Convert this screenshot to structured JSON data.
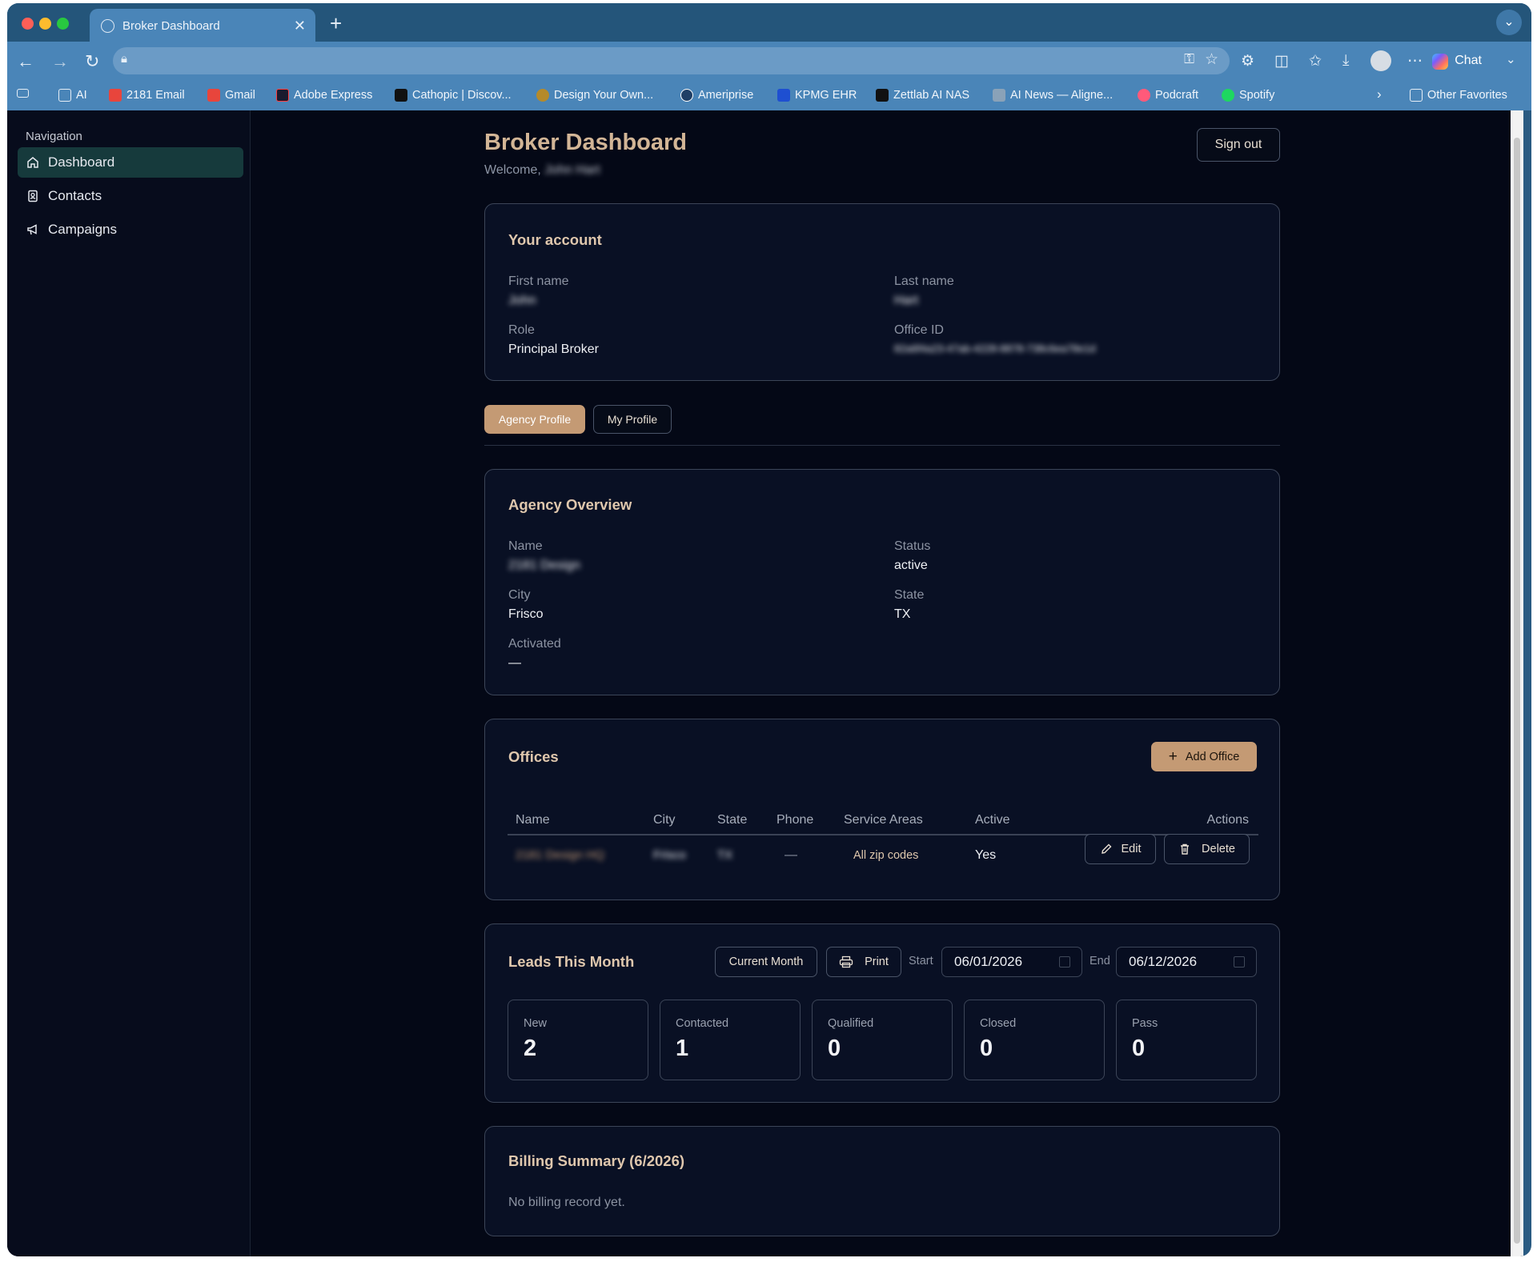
{
  "browser": {
    "tab_title": "Broker Dashboard",
    "chat_label": "Chat",
    "bookmarks": [
      {
        "label": "AI",
        "icon": "folder-icon"
      },
      {
        "label": "2181 Email",
        "icon": "gmail-icon"
      },
      {
        "label": "Gmail",
        "icon": "gmail-icon"
      },
      {
        "label": "Adobe Express",
        "icon": "adobe-express-icon"
      },
      {
        "label": "Cathopic | Discov...",
        "icon": "cathopic-icon"
      },
      {
        "label": "Design Your Own...",
        "icon": "design-icon"
      },
      {
        "label": "Ameriprise",
        "icon": "ameriprise-icon"
      },
      {
        "label": "KPMG EHR",
        "icon": "kpmg-icon"
      },
      {
        "label": "Zettlab AI NAS",
        "icon": "zettlab-icon"
      },
      {
        "label": "AI News — Aligne...",
        "icon": "ai-news-icon"
      },
      {
        "label": "Podcraft",
        "icon": "podcraft-icon"
      },
      {
        "label": "Spotify",
        "icon": "spotify-icon"
      }
    ],
    "other_favorites": "Other Favorites"
  },
  "sidebar": {
    "title": "Navigation",
    "items": [
      {
        "label": "Dashboard",
        "icon": "home-icon",
        "active": true
      },
      {
        "label": "Contacts",
        "icon": "contact-book-icon",
        "active": false
      },
      {
        "label": "Campaigns",
        "icon": "megaphone-icon",
        "active": false
      }
    ]
  },
  "header": {
    "title": "Broker Dashboard",
    "welcome_prefix": "Welcome,",
    "welcome_name": "John Hart",
    "signout_label": "Sign out"
  },
  "account": {
    "heading": "Your account",
    "first_name_label": "First name",
    "first_name": "John",
    "last_name_label": "Last name",
    "last_name": "Hart",
    "role_label": "Role",
    "role": "Principal Broker",
    "office_id_label": "Office ID",
    "office_id": "82a6f4a23-47ab-4228-8878-738c6ea78e1d"
  },
  "profile_tabs": [
    {
      "label": "Agency Profile",
      "active": true
    },
    {
      "label": "My Profile",
      "active": false
    }
  ],
  "agency": {
    "heading": "Agency Overview",
    "name_label": "Name",
    "name": "2181 Design",
    "status_label": "Status",
    "status": "active",
    "city_label": "City",
    "city": "Frisco",
    "state_label": "State",
    "state": "TX",
    "activated_label": "Activated",
    "activated": "—"
  },
  "offices": {
    "heading": "Offices",
    "add_label": "Add Office",
    "columns": [
      "Name",
      "City",
      "State",
      "Phone",
      "Service Areas",
      "Active",
      "Actions"
    ],
    "rows": [
      {
        "name": "2181 Design HQ",
        "city": "Frisco",
        "state": "TX",
        "phone": "—",
        "service_areas": "All zip codes",
        "active": "Yes",
        "edit_label": "Edit",
        "delete_label": "Delete"
      }
    ]
  },
  "leads": {
    "heading": "Leads This Month",
    "current_month_label": "Current Month",
    "print_label": "Print",
    "start_label": "Start",
    "start_date": "06/01/2026",
    "end_label": "End",
    "end_date": "06/12/2026",
    "stats": [
      {
        "label": "New",
        "value": "2"
      },
      {
        "label": "Contacted",
        "value": "1"
      },
      {
        "label": "Qualified",
        "value": "0"
      },
      {
        "label": "Closed",
        "value": "0"
      },
      {
        "label": "Pass",
        "value": "0"
      }
    ]
  },
  "billing": {
    "heading": "Billing Summary (6/2026)",
    "message": "No billing record yet."
  },
  "colors": {
    "accent": "#c49a74",
    "heading": "#dfc7ad",
    "background": "#040816",
    "card": "#091024",
    "active_nav": "#163a3c"
  }
}
